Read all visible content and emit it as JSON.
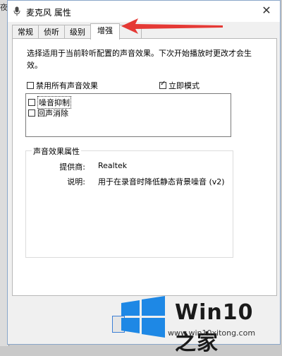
{
  "background": {
    "left_char": "夜"
  },
  "window": {
    "title": "麦克风 属性",
    "close_glyph": "✕"
  },
  "tabs": [
    {
      "label": "常规",
      "active": false
    },
    {
      "label": "侦听",
      "active": false
    },
    {
      "label": "级别",
      "active": false
    },
    {
      "label": "增强",
      "active": true
    }
  ],
  "enhancements": {
    "description": "选择适用于当前聆听配置的声音效果。下次开始播放时更改才会生效。",
    "disable_all": {
      "label": "禁用所有声音效果",
      "checked": false
    },
    "immediate_mode": {
      "label": "立即模式",
      "checked": true
    },
    "effects": [
      {
        "label": "噪音抑制",
        "checked": false,
        "selected": true
      },
      {
        "label": "回声消除",
        "checked": false,
        "selected": false
      }
    ],
    "properties": {
      "title": "声音效果属性",
      "provider_label": "提供商:",
      "provider_value": "Realtek",
      "description_label": "说明:",
      "description_value": "用于在录音时降低静态背景噪音 (v2)"
    }
  },
  "watermark": {
    "name": "Win10 之家",
    "url": "www.win10xitong.com"
  },
  "colors": {
    "arrow": "#e53935",
    "logo_blue": "#1e88e5",
    "focus_blue": "#3c7fd6"
  }
}
